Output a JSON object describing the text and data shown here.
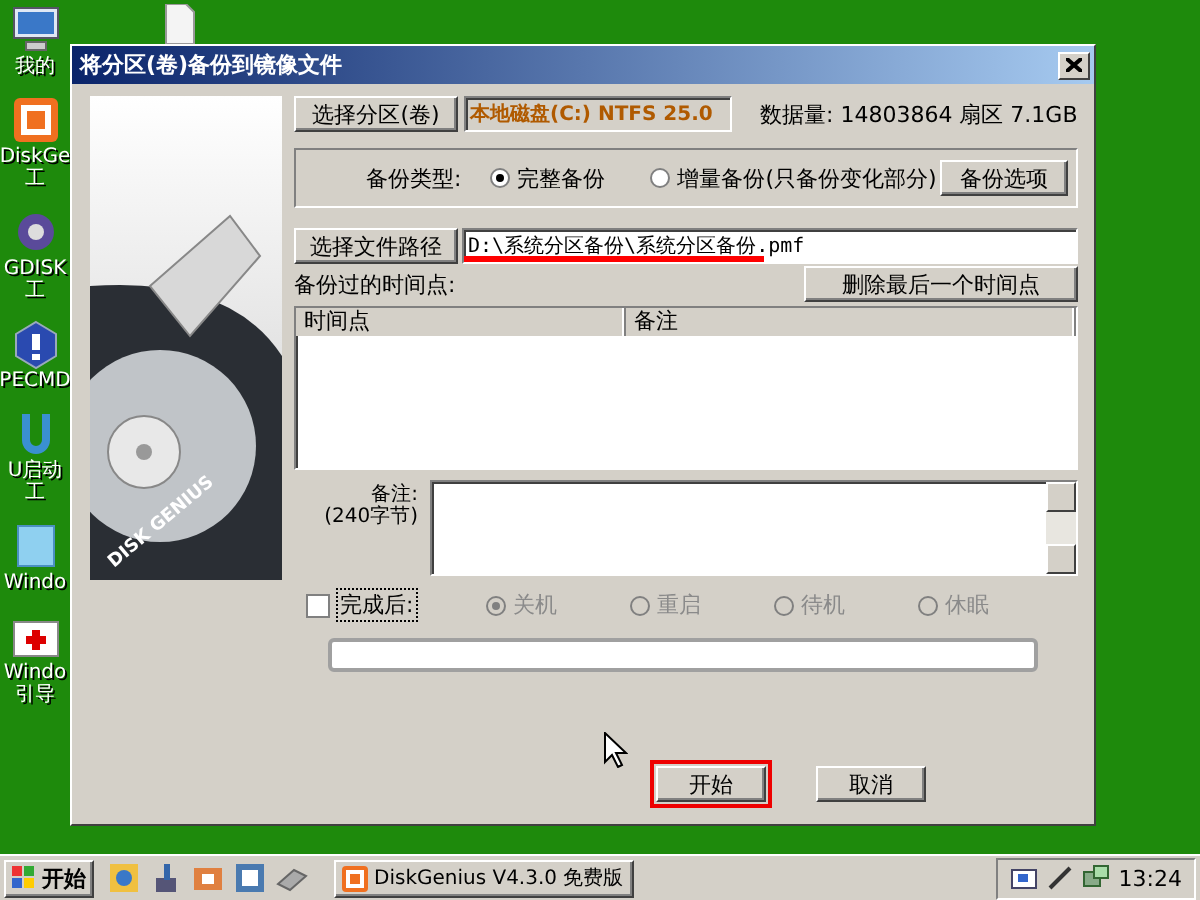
{
  "desktop": {
    "icons": [
      {
        "kind": "computer",
        "label": "我的"
      },
      {
        "kind": "app",
        "label": "DiskGe",
        "label2": "工"
      },
      {
        "kind": "gear",
        "label": "GDISK",
        "label2": "工"
      },
      {
        "kind": "help",
        "label": "PECMD"
      },
      {
        "kind": "u",
        "label": "U启动",
        "label2": "工"
      },
      {
        "kind": "window",
        "label": "Windo"
      },
      {
        "kind": "kit",
        "label": "Windo",
        "label2": "引导"
      }
    ]
  },
  "dialog": {
    "title": "将分区(卷)备份到镜像文件",
    "image_caption": "DISK GENIUS",
    "select_partition_button": "选择分区(卷)",
    "partition_value": "本地磁盘(C:) NTFS 25.0",
    "data_size": "数据量: 14803864 扇区  7.1GB",
    "backup_type_label": "备份类型:",
    "backup_types": [
      {
        "label": "完整备份",
        "selected": true
      },
      {
        "label": "增量备份(只备份变化部分)",
        "selected": false
      }
    ],
    "backup_options_button": "备份选项",
    "select_path_button": "选择文件路径",
    "path_field": {
      "value": "D:\\系统分区备份\\系统分区备份.pmf",
      "highlighted": true
    },
    "timepoints_label": "备份过的时间点:",
    "delete_last_button": "删除最后一个时间点",
    "table": {
      "columns": [
        "时间点",
        "备注"
      ]
    },
    "note_label": "备注:",
    "note_hint": "(240字节)",
    "after_done": {
      "label": "完成后:",
      "checked": false
    },
    "after_options": [
      {
        "label": "关机",
        "selected": true,
        "disabled": true
      },
      {
        "label": "重启",
        "selected": false,
        "disabled": true
      },
      {
        "label": "待机",
        "selected": false,
        "disabled": true
      },
      {
        "label": "休眠",
        "selected": false,
        "disabled": true
      }
    ],
    "buttons": [
      {
        "label": "开始",
        "highlighted": true
      },
      {
        "label": "取消",
        "highlighted": false
      }
    ]
  },
  "taskbar": {
    "start": "开始",
    "quick_launch": [
      {
        "kind": "browser"
      },
      {
        "kind": "cleaner"
      },
      {
        "kind": "folder"
      },
      {
        "kind": "monitor"
      },
      {
        "kind": "eraser"
      }
    ],
    "tasks": [
      {
        "label": "DiskGenius V4.3.0 免费版",
        "selected": false
      }
    ],
    "clock": "13:24"
  }
}
